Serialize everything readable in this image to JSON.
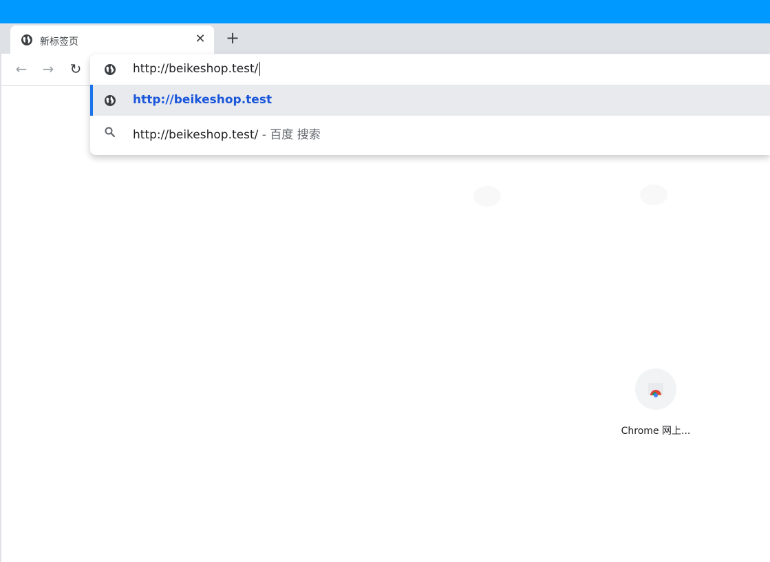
{
  "tab": {
    "title": "新标签页",
    "close_glyph": "✕"
  },
  "new_tab_glyph": "+",
  "nav": {
    "back": "←",
    "forward": "→",
    "reload": "↻"
  },
  "omnibox": {
    "input_value": "http://beikeshop.test/",
    "suggestions": [
      {
        "icon": "globe-icon",
        "text": "http://beikeshop.test",
        "selected": true
      },
      {
        "icon": "search-icon",
        "text": "http://beikeshop.test/",
        "suffix": " - 百度 搜索",
        "selected": false
      }
    ]
  },
  "shortcut": {
    "label": "Chrome 网上..."
  },
  "colors": {
    "top_band": "#0099ff",
    "tabstrip": "#dee1e6",
    "selected_text": "#1a56db",
    "selection_bar": "#1a73e8",
    "selected_row_bg": "#e8eaed"
  }
}
